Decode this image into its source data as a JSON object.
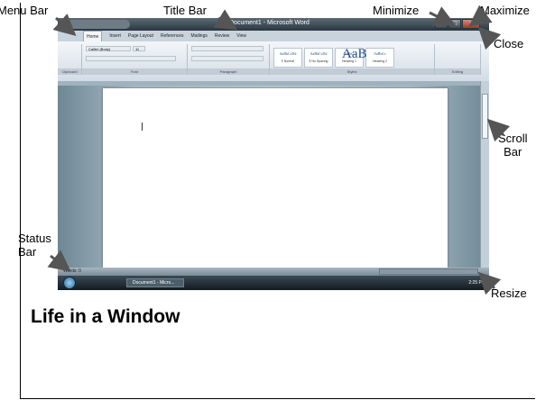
{
  "callouts": {
    "menu_bar": "Menu Bar",
    "title_bar": "Title Bar",
    "minimize": "Minimize",
    "maximize": "Maximize",
    "close": "Close",
    "scroll_bar": "Scroll\nBar",
    "status_bar": "Status\nBar",
    "resize": "Resize"
  },
  "window": {
    "title": "Document1 - Microsoft Word",
    "tabs": [
      "Home",
      "Insert",
      "Page Layout",
      "References",
      "Mailings",
      "Review",
      "View"
    ],
    "ribbon_groups": [
      "Clipboard",
      "Font",
      "Paragraph",
      "Styles",
      "Editing"
    ],
    "styles": [
      {
        "sample": "AaBbCcDd",
        "name": "¶ Normal"
      },
      {
        "sample": "AaBbCcDd",
        "name": "¶ No Spacing"
      },
      {
        "sample": "AaBbCc",
        "name": "Heading 1"
      },
      {
        "sample": "AaBbCc",
        "name": "Heading 2"
      }
    ],
    "big_style": "AaB",
    "font_name": "Calibri (Body)",
    "font_size": "11",
    "taskbar_item": "Document1 - Micro...",
    "tray_time": "2:25 PM",
    "status_left": "Words: 0"
  },
  "slide": {
    "title": "Life in a Window"
  },
  "colors": {
    "titlebar": "#2a3740",
    "ribbon": "#d3dce5",
    "document_background": "#b6c8d1",
    "taskbar": "#121a20"
  },
  "icons": [
    "start-orb-icon",
    "window-control-icons",
    "cursor-icon"
  ]
}
